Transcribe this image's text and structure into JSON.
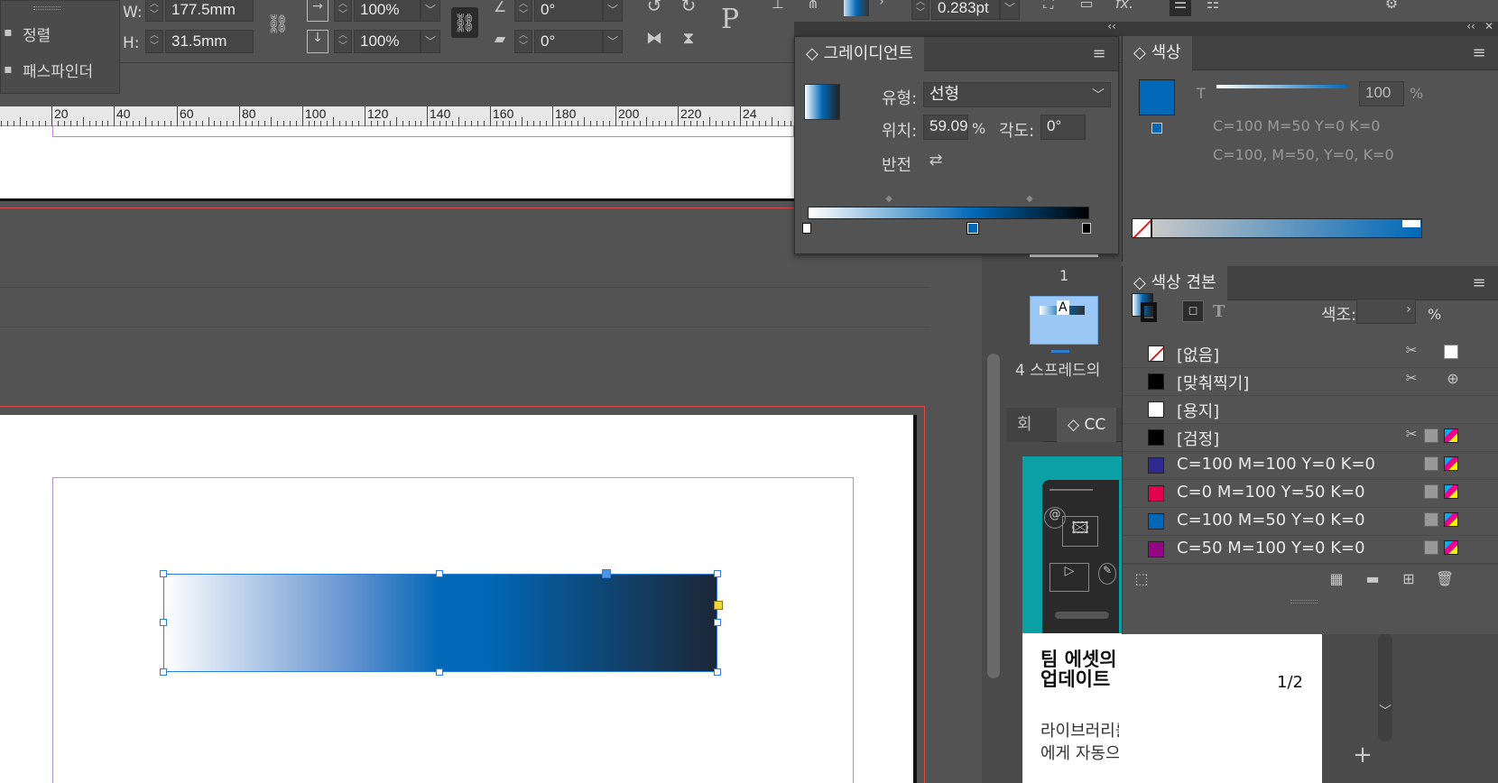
{
  "toolbar": {
    "w_label": "W:",
    "w_value": "177.5mm",
    "h_label": "H:",
    "h_value": "31.5mm",
    "scale_x": "100%",
    "scale_y": "100%",
    "rotate_angle": "0°",
    "shear_angle": "0°",
    "stroke_weight": "0.283pt"
  },
  "left_panel": {
    "align_label": "정렬",
    "pathfinder_label": "패스파인더"
  },
  "ruler": {
    "ticks": [
      "20",
      "40",
      "60",
      "80",
      "100",
      "120",
      "140",
      "160",
      "180",
      "200",
      "220",
      "24"
    ]
  },
  "gradient_panel": {
    "title": "그레이디언트",
    "type_label": "유형:",
    "type_value": "선형",
    "location_label": "위치:",
    "location_value": "59.09",
    "location_unit": "%",
    "angle_label": "각도:",
    "angle_value": "0°",
    "reverse_label": "반전"
  },
  "color_panel": {
    "title": "색상",
    "tint_value": "100",
    "tint_unit": "%",
    "color_line1": "C=100 M=50 Y=0 K=0",
    "color_line2": "C=100, M=50, Y=0, K=0",
    "t_label": "T"
  },
  "swatches_panel": {
    "title": "색상 견본",
    "tint_label": "색조:",
    "tint_unit": "%",
    "t_label": "T",
    "swatches": [
      {
        "name": "[없음]",
        "color": "none"
      },
      {
        "name": "[맞춰찍기]",
        "color": "#000000"
      },
      {
        "name": "[용지]",
        "color": "#ffffff"
      },
      {
        "name": "[검정]",
        "color": "#000000"
      },
      {
        "name": "C=100 M=100 Y=0 K=0",
        "color": "#2e2a8e"
      },
      {
        "name": "C=0 M=100 Y=50 K=0",
        "color": "#e5004f"
      },
      {
        "name": "C=100 M=50 Y=0 K=0",
        "color": "#0068b7"
      },
      {
        "name": "C=50 M=100 Y=0 K=0",
        "color": "#920783"
      }
    ]
  },
  "pages_panel": {
    "page_number": "1",
    "master_letter": "A",
    "spread_info": "4 스프레드의"
  },
  "cc_panel": {
    "tab1": "회",
    "tab2": "CC",
    "card_title": "팀 에셋의 원활한 공유 및 업데이트",
    "card_page": "1/2",
    "card_body": "라이브러리를 팀과 공유하면 모든 팀원에게 자동으로 공유됩니다"
  },
  "colors": {
    "panel_bg": "#535353",
    "panel_dark": "#424242",
    "gradient_start": "#ffffff",
    "gradient_mid": "#0068b7",
    "gradient_end": "#000000",
    "selection": "#2d7fd6",
    "accent_teal": "#00a0a8"
  }
}
